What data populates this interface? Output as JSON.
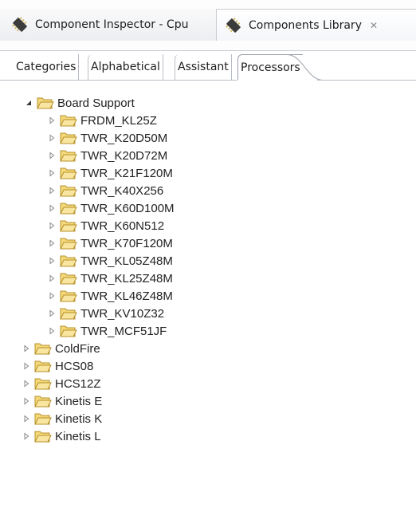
{
  "view_tabs": {
    "inspector_label": "Component Inspector - Cpu",
    "library_label": "Components Library",
    "close_glyph": "✕"
  },
  "sub_tabs": [
    "Categories",
    "Alphabetical",
    "Assistant",
    "Processors"
  ],
  "tree": {
    "root": "Board Support",
    "root_expanded": true,
    "root_children": [
      "FRDM_KL25Z",
      "TWR_K20D50M",
      "TWR_K20D72M",
      "TWR_K21F120M",
      "TWR_K40X256",
      "TWR_K60D100M",
      "TWR_K60N512",
      "TWR_K70F120M",
      "TWR_KL05Z48M",
      "TWR_KL25Z48M",
      "TWR_KL46Z48M",
      "TWR_KV10Z32",
      "TWR_MCF51JF"
    ],
    "siblings": [
      "ColdFire",
      "HCS08",
      "HCS12Z",
      "Kinetis E",
      "Kinetis K",
      "Kinetis L"
    ]
  },
  "colors": {
    "folder_fill": "#f3d97a",
    "folder_stroke": "#b8902a",
    "chip_body": "#3b3b3b",
    "chip_legs": "#d7c079"
  }
}
